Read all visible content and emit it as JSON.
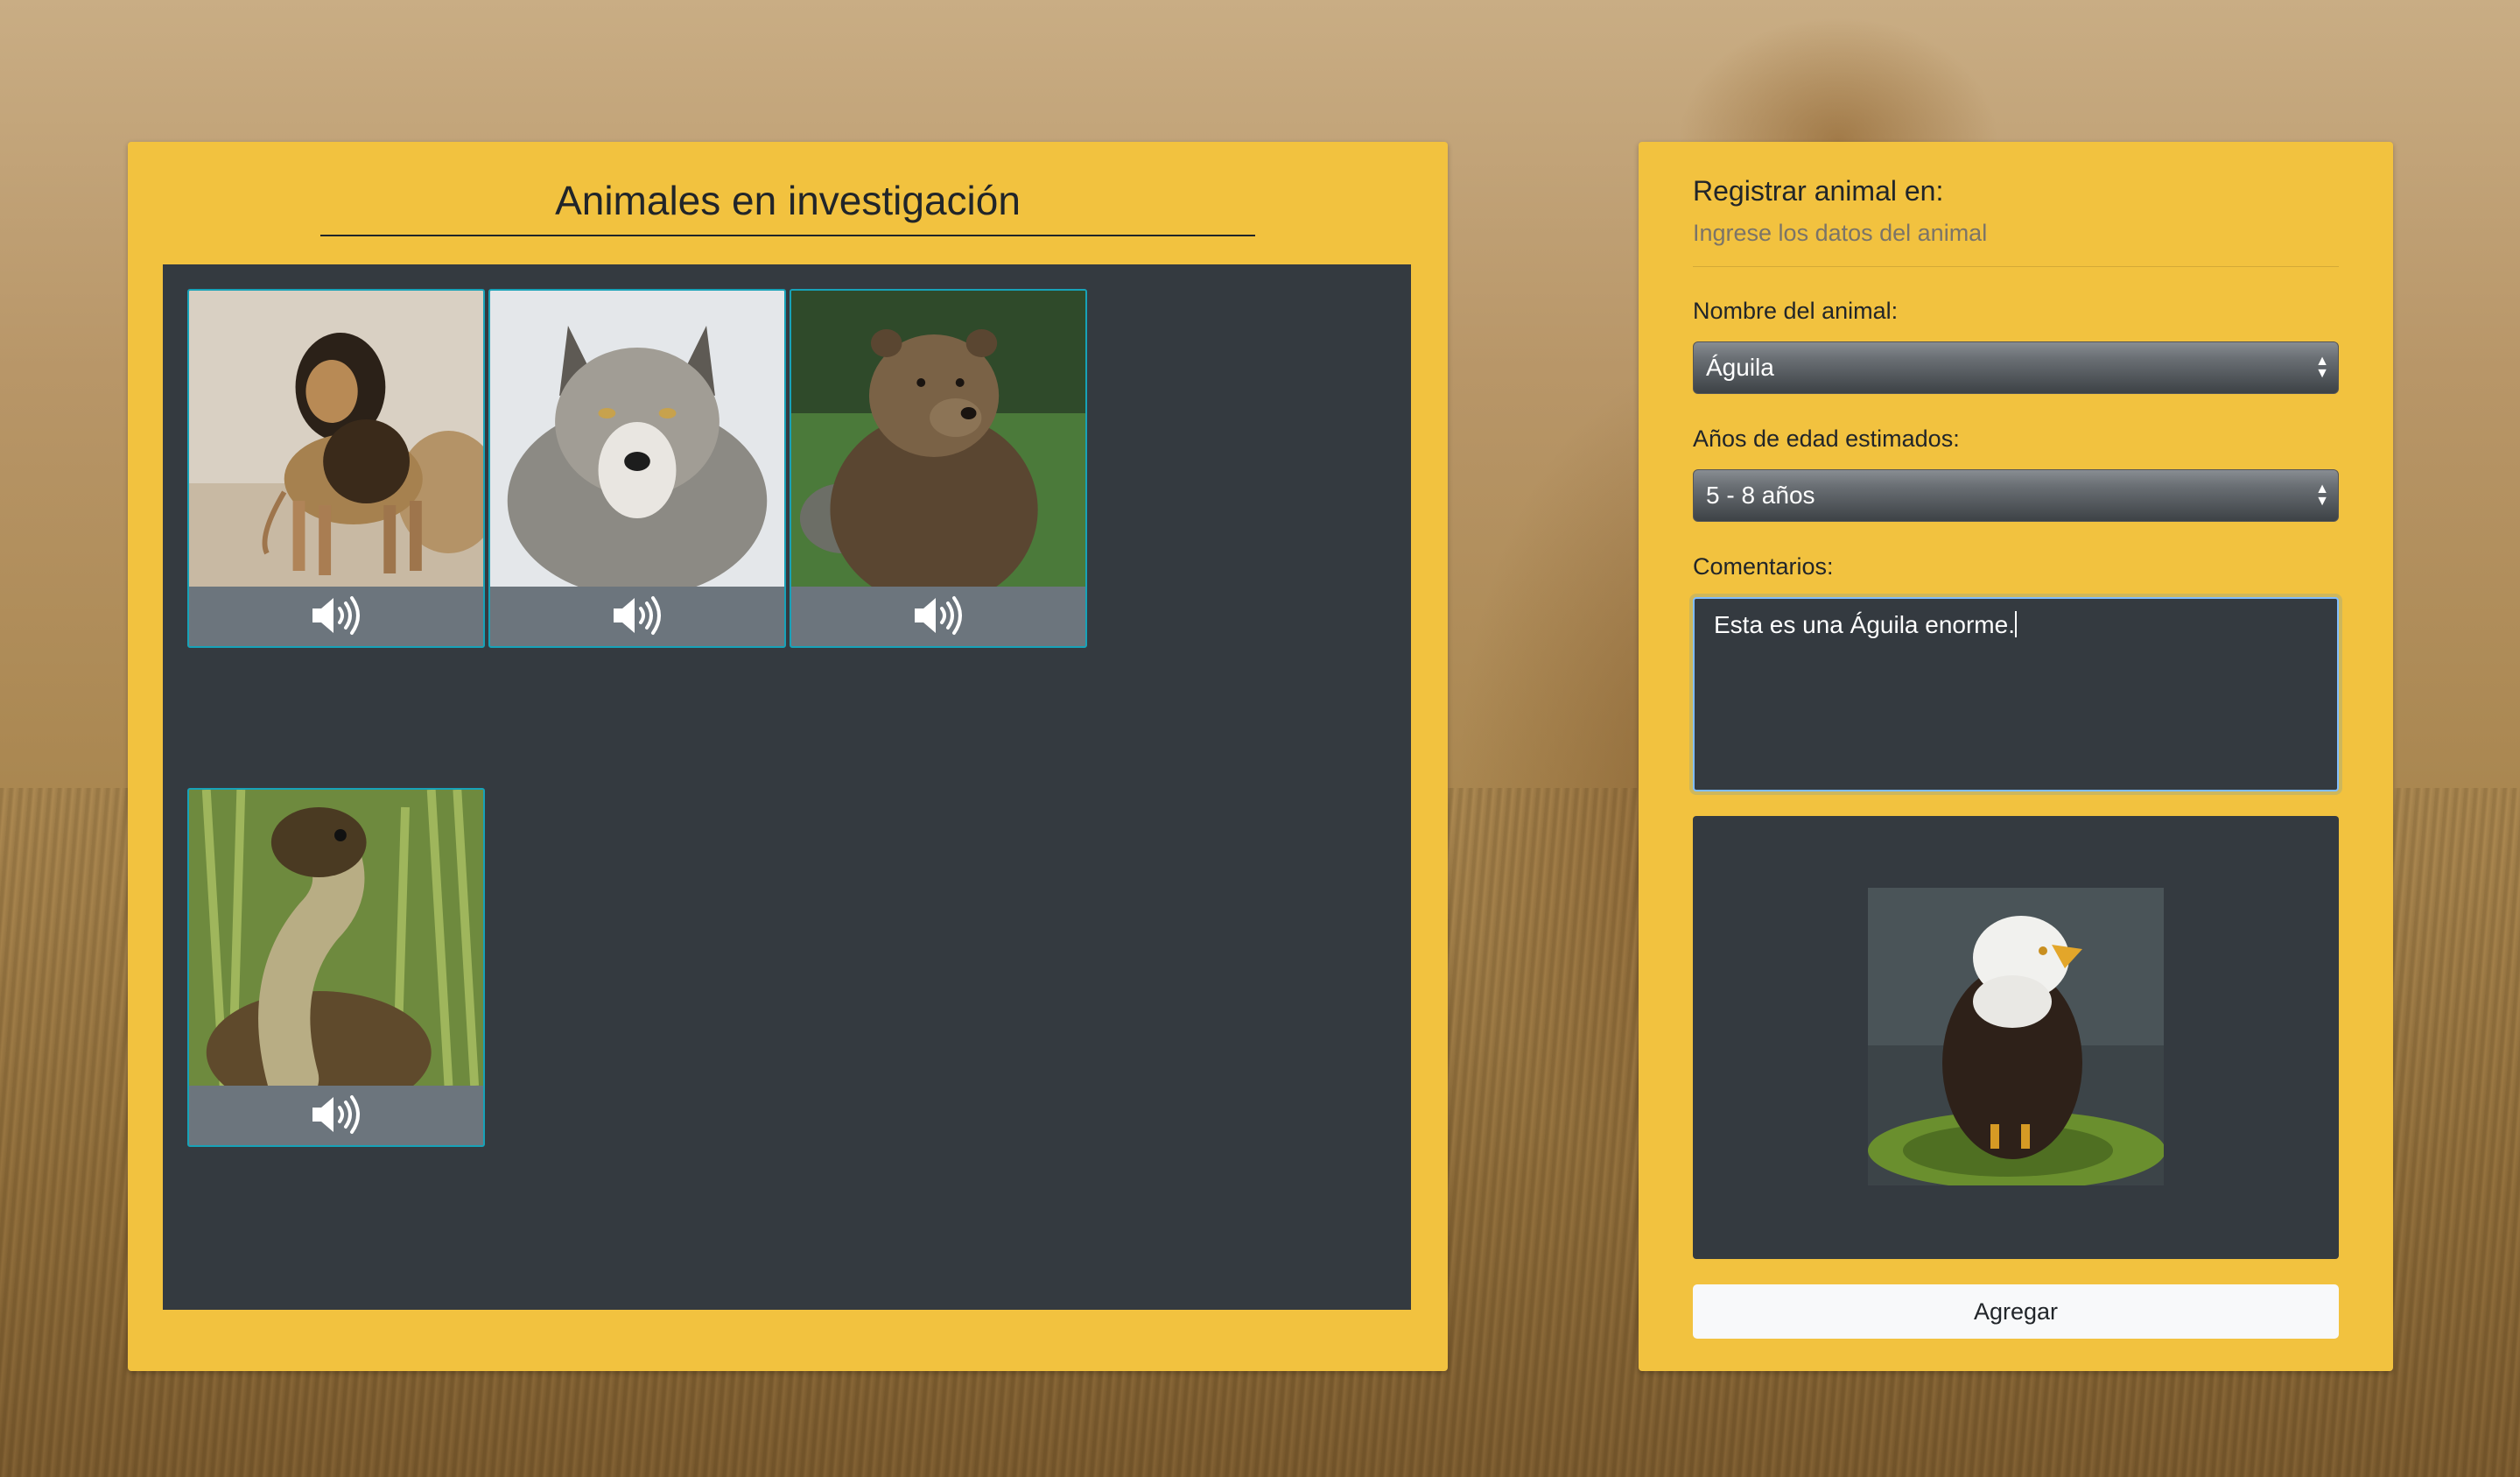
{
  "gallery": {
    "title": "Animales en investigación",
    "cards": [
      {
        "animal": "lion",
        "sound_icon": "volume-icon"
      },
      {
        "animal": "wolf",
        "sound_icon": "volume-icon"
      },
      {
        "animal": "bear",
        "sound_icon": "volume-icon"
      },
      {
        "animal": "snake",
        "sound_icon": "volume-icon"
      }
    ]
  },
  "form": {
    "title": "Registrar animal en:",
    "subtitle": "Ingrese los datos del animal",
    "name_label": "Nombre del animal:",
    "name_value": "Águila",
    "age_label": "Años de edad estimados:",
    "age_value": "5 - 8 años",
    "comments_label": "Comentarios:",
    "comments_value": "Esta es una Águila enorme.",
    "preview_animal": "eagle",
    "add_button": "Agregar"
  },
  "colors": {
    "panel": "#f2c23f",
    "dark": "#343a40",
    "card_border": "#17a2b8",
    "card_footer": "#6c757d"
  }
}
